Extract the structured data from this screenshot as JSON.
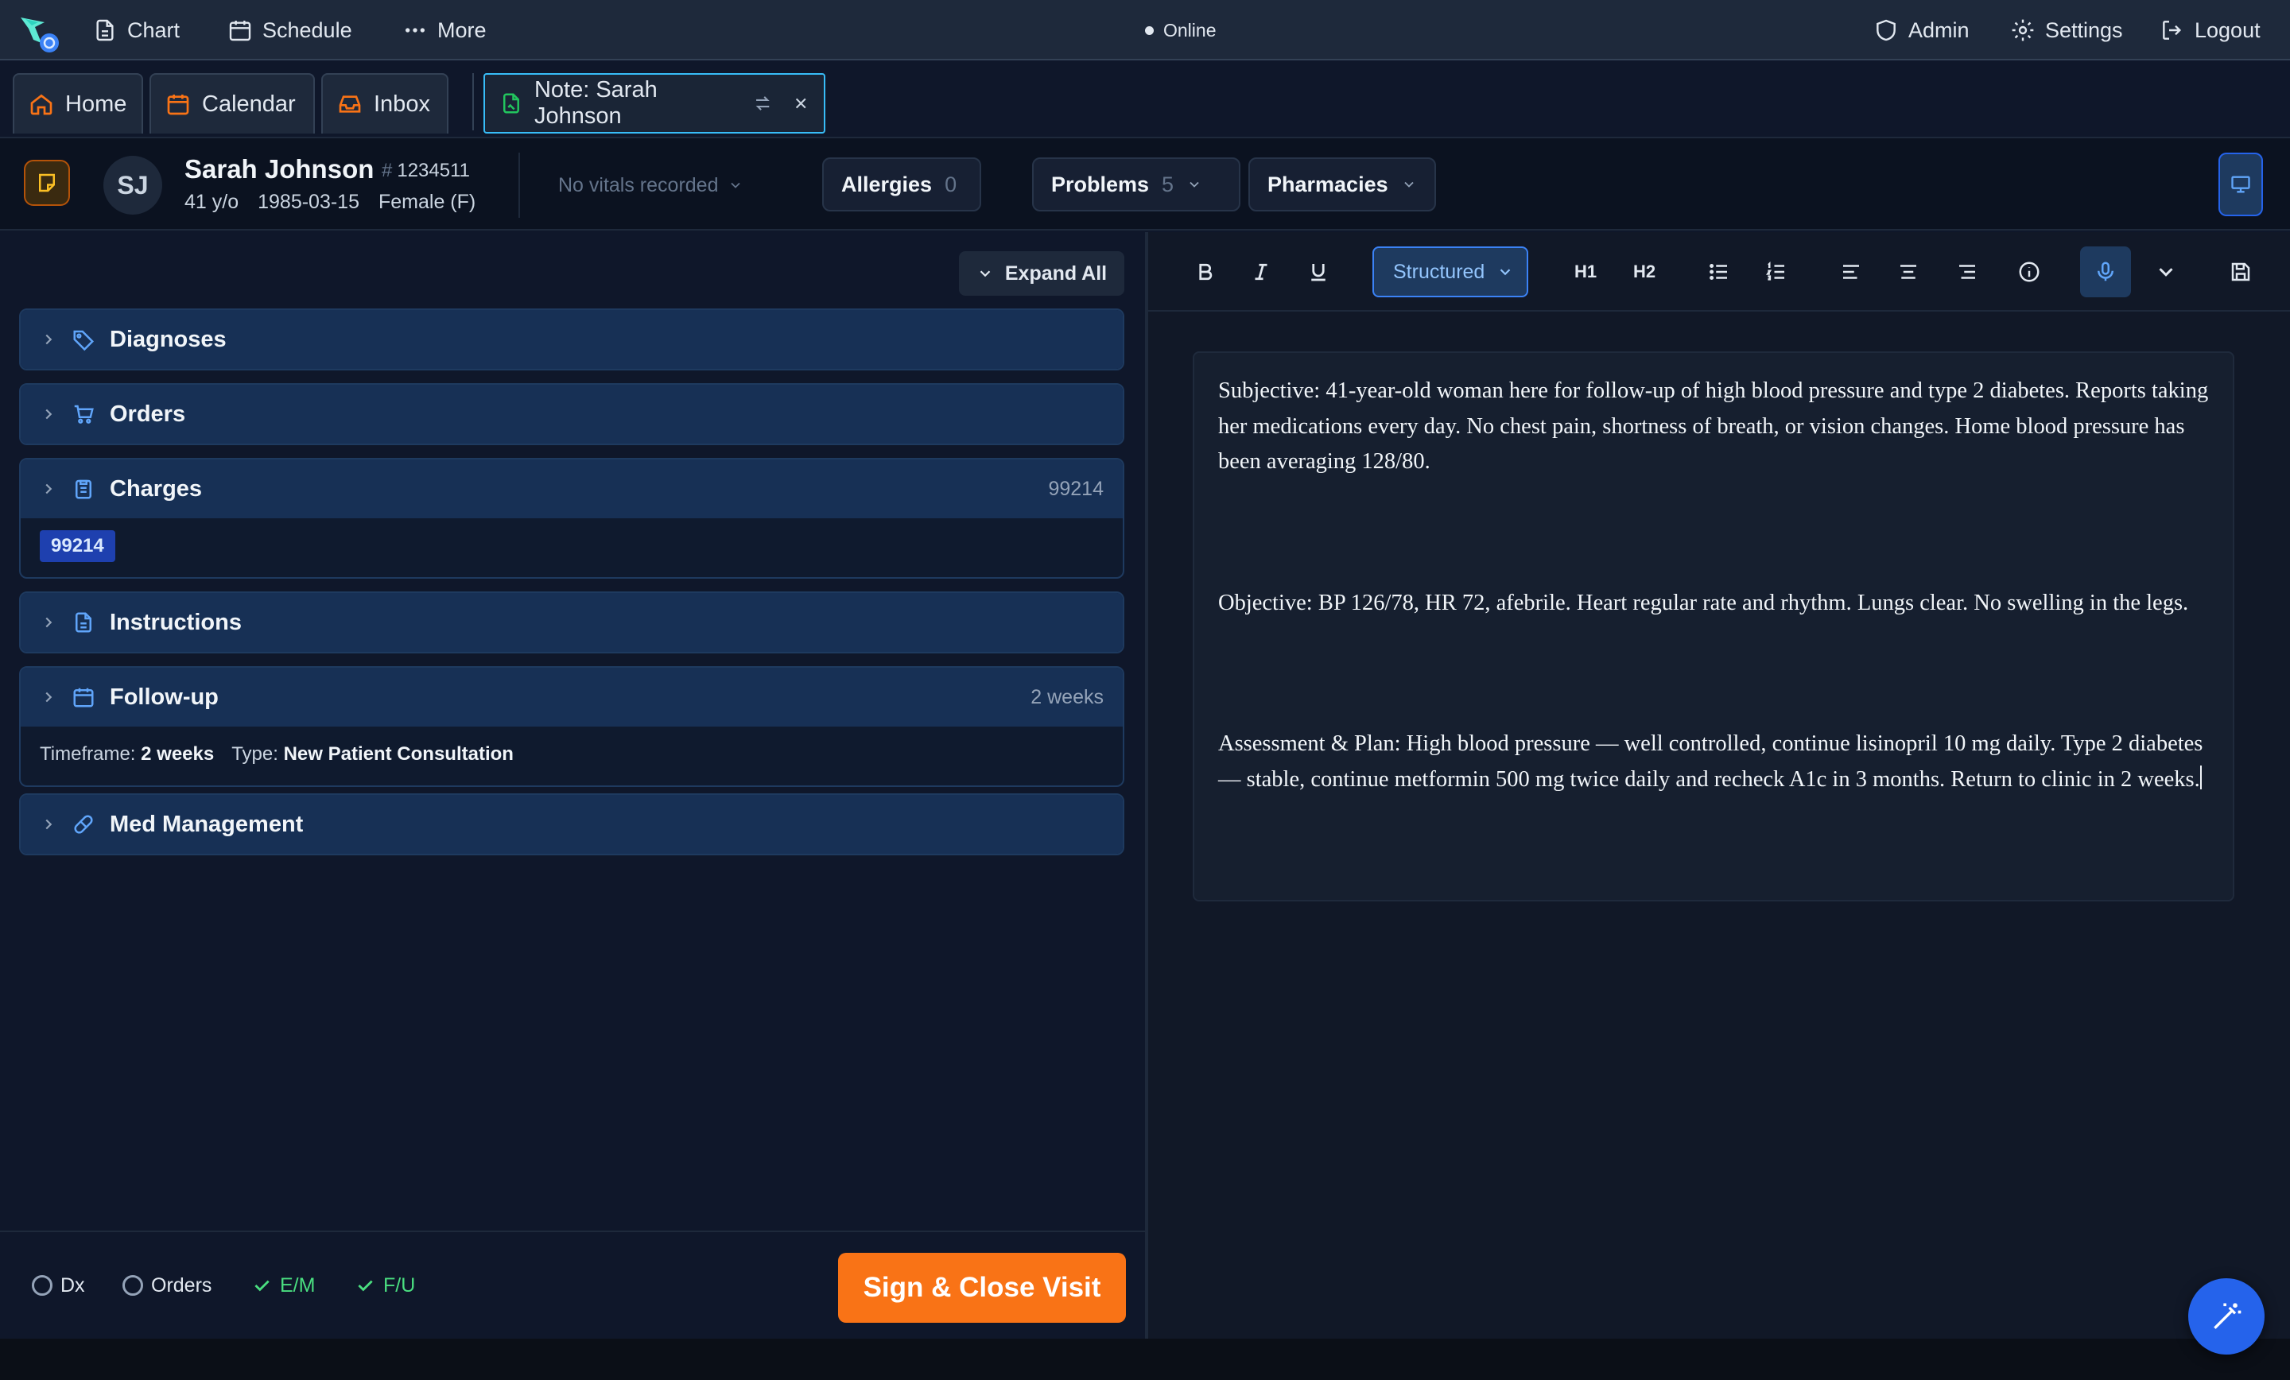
{
  "topbar": {
    "nav": [
      {
        "label": "Chart",
        "icon": "document-icon"
      },
      {
        "label": "Schedule",
        "icon": "calendar-icon"
      },
      {
        "label": "More",
        "icon": "ellipsis-icon"
      }
    ],
    "status": "Online",
    "right": [
      {
        "label": "Admin",
        "icon": "shield-icon"
      },
      {
        "label": "Settings",
        "icon": "gear-icon"
      },
      {
        "label": "Logout",
        "icon": "logout-icon"
      }
    ]
  },
  "tabs": [
    {
      "label": "Home",
      "icon": "home-icon"
    },
    {
      "label": "Calendar",
      "icon": "calendar-icon"
    },
    {
      "label": "Inbox",
      "icon": "inbox-icon"
    },
    {
      "label": "Note: Sarah Johnson",
      "icon": "note-icon",
      "active": true
    }
  ],
  "patient": {
    "initials": "SJ",
    "name": "Sarah Johnson",
    "mrn": "1234511",
    "age": "41 y/o",
    "dob": "1985-03-15",
    "sex": "Female (F)",
    "vitals": "No vitals recorded",
    "allergies": {
      "label": "Allergies",
      "count": "0"
    },
    "problems": {
      "label": "Problems",
      "count": "5"
    },
    "pharmacies": {
      "label": "Pharmacies"
    }
  },
  "left": {
    "expand_all": "Expand All",
    "sections": {
      "diagnoses": {
        "title": "Diagnoses"
      },
      "orders": {
        "title": "Orders"
      },
      "charges": {
        "title": "Charges",
        "summary": "99214",
        "code": "99214"
      },
      "instructions": {
        "title": "Instructions"
      },
      "followup": {
        "title": "Follow-up",
        "summary": "2 weeks",
        "timeframe_label": "Timeframe:",
        "timeframe": "2 weeks",
        "type_label": "Type:",
        "type": "New Patient Consultation"
      },
      "med": {
        "title": "Med Management"
      }
    },
    "footer": {
      "checks": [
        {
          "label": "Dx",
          "done": false
        },
        {
          "label": "Orders",
          "done": false
        },
        {
          "label": "E/M",
          "done": true
        },
        {
          "label": "F/U",
          "done": true
        }
      ],
      "sign": "Sign & Close Visit"
    }
  },
  "editor": {
    "mode": "Structured",
    "h1": "H1",
    "h2": "H2",
    "subjective": "Subjective: 41-year-old woman here for follow-up of high blood pressure and type 2 diabetes. Reports taking her medications every day. No chest pain, shortness of breath, or vision changes. Home blood pressure has been averaging 128/80.",
    "objective": "Objective: BP 126/78, HR 72, afebrile. Heart regular rate and rhythm. Lungs clear. No swelling in the legs.",
    "assessment": "Assessment & Plan: High blood pressure — well controlled, continue lisinopril 10 mg daily. Type 2 diabetes — stable, continue metformin 500 mg twice daily and recheck A1c in 3 months. Return to clinic in 2 weeks."
  },
  "colors": {
    "accent": "#f97316",
    "primary": "#2563eb",
    "success": "#4ade80"
  }
}
